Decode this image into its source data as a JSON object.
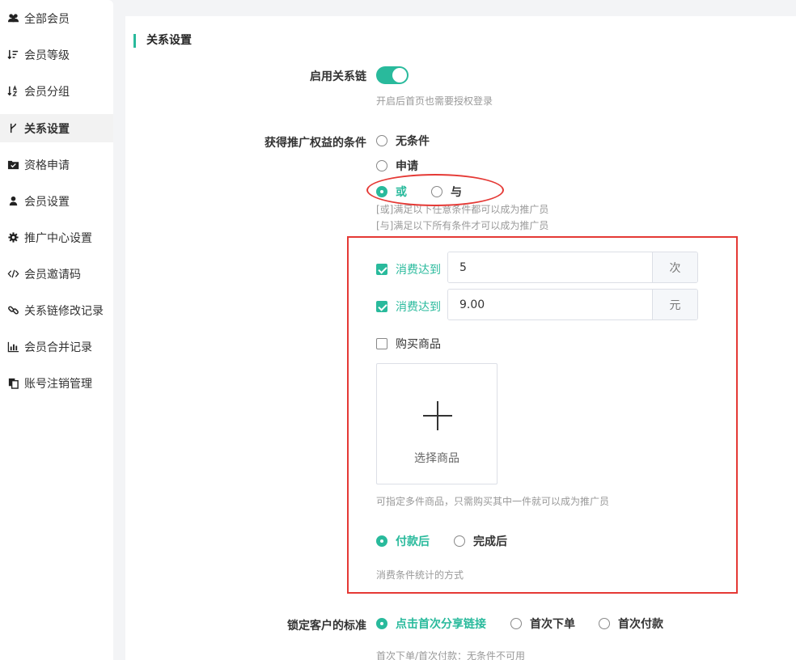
{
  "sidebar": {
    "items": [
      {
        "label": "全部会员",
        "icon": "users-icon"
      },
      {
        "label": "会员等级",
        "icon": "sort-amount-icon"
      },
      {
        "label": "会员分组",
        "icon": "sort-alpha-icon"
      },
      {
        "label": "关系设置",
        "icon": "branch-icon",
        "active": true
      },
      {
        "label": "资格申请",
        "icon": "folder-check-icon"
      },
      {
        "label": "会员设置",
        "icon": "user-icon"
      },
      {
        "label": "推广中心设置",
        "icon": "gear-icon"
      },
      {
        "label": "会员邀请码",
        "icon": "code-icon"
      },
      {
        "label": "关系链修改记录",
        "icon": "link-icon"
      },
      {
        "label": "会员合并记录",
        "icon": "bar-chart-icon"
      },
      {
        "label": "账号注销管理",
        "icon": "copy-icon"
      }
    ]
  },
  "section": {
    "title": "关系设置"
  },
  "relation_chain": {
    "label": "启用关系链",
    "enabled": true,
    "hint": "开启后首页也需要授权登录"
  },
  "promote_condition": {
    "label": "获得推广权益的条件",
    "options": {
      "none": "无条件",
      "apply": "申请",
      "or": "或",
      "and": "与"
    },
    "selected": "或",
    "hint_or": "[或]满足以下任意条件都可以成为推广员",
    "hint_and": "[与]满足以下所有条件才可以成为推广员",
    "conditions": {
      "consume_count": {
        "label": "消费达到",
        "checked": true,
        "value": "5",
        "unit": "次"
      },
      "consume_amount": {
        "label": "消费达到",
        "checked": true,
        "value": "9.00",
        "unit": "元"
      },
      "buy_goods": {
        "label": "购买商品",
        "checked": false,
        "select_label": "选择商品",
        "hint": "可指定多件商品，只需购买其中一件就可以成为推广员"
      }
    },
    "stat_mode": {
      "options": {
        "paid": "付款后",
        "completed": "完成后"
      },
      "selected": "付款后",
      "hint": "消费条件统计的方式"
    }
  },
  "lock_customer": {
    "label": "锁定客户的标准",
    "options": {
      "click_share": "点击首次分享链接",
      "first_order": "首次下单",
      "first_pay": "首次付款"
    },
    "selected": "点击首次分享链接",
    "hint": "首次下单/首次付款：无条件不可用"
  },
  "colors": {
    "accent": "#29ba9c",
    "annotation": "#e53935"
  }
}
